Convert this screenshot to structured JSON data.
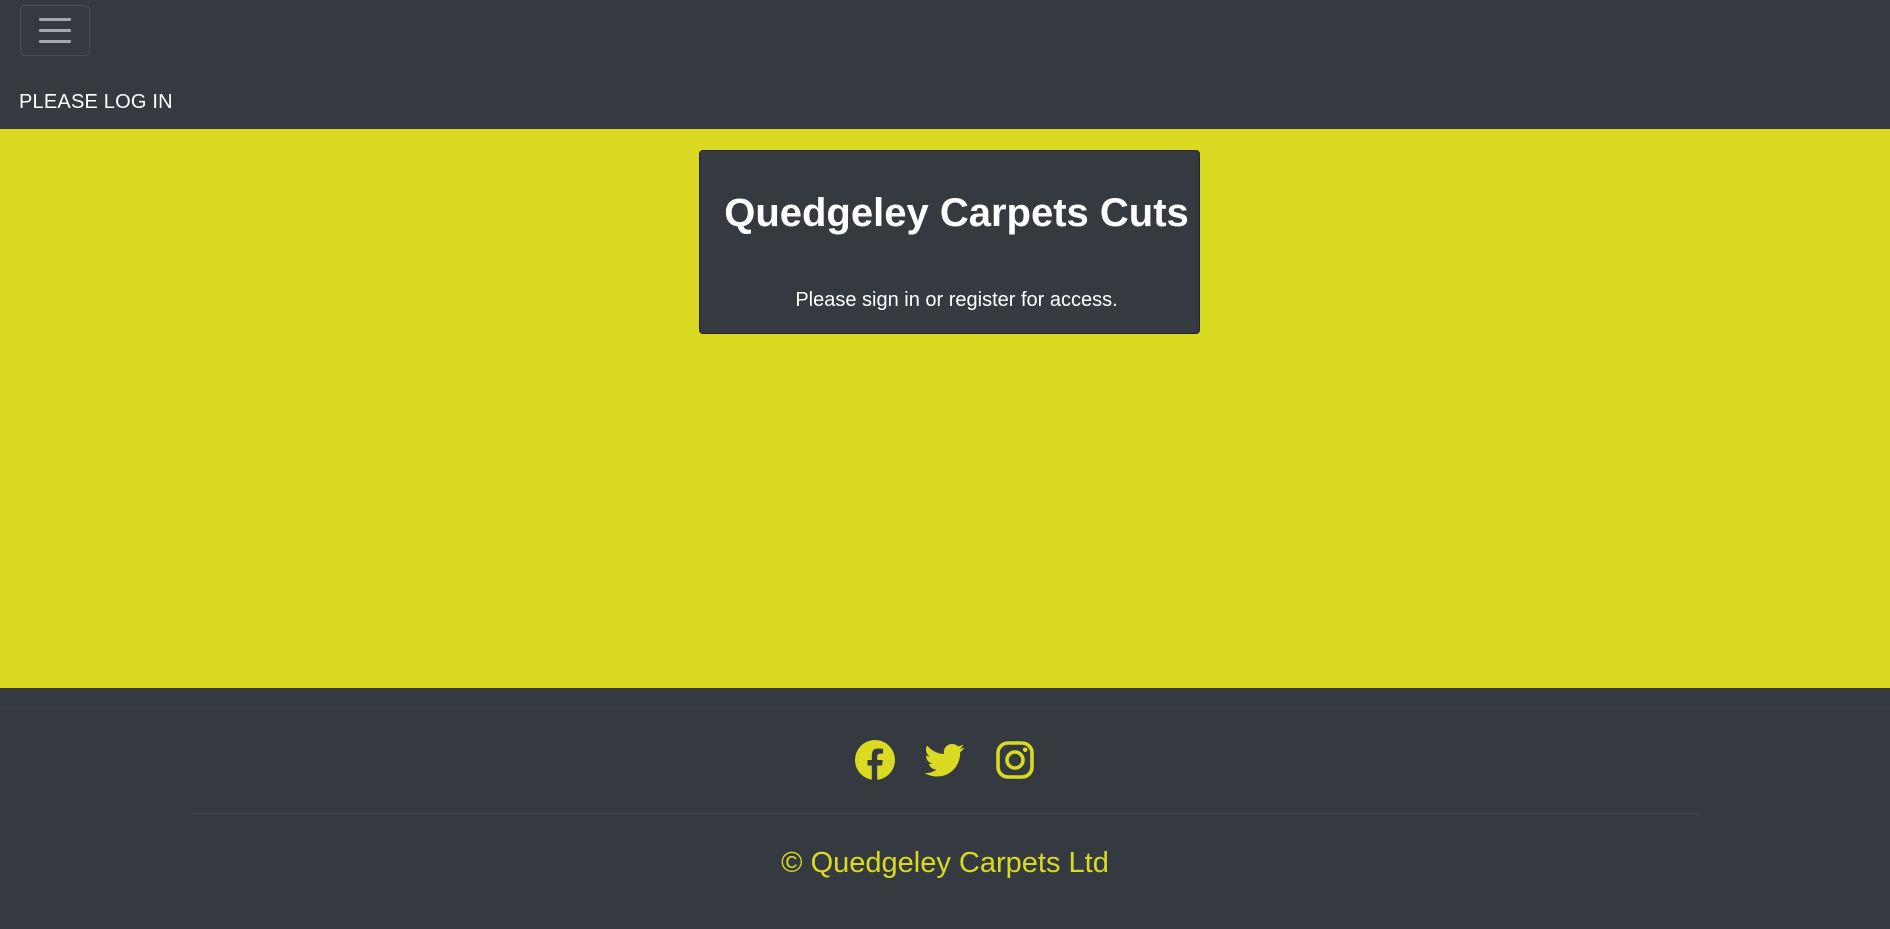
{
  "navbar": {
    "toggler_icon": "hamburger-menu-icon",
    "login_link": "PLEASE LOG IN"
  },
  "card": {
    "title": "Quedgeley Carpets Cuts",
    "text": "Please sign in or register for access."
  },
  "footer": {
    "social": [
      {
        "name": "facebook-icon"
      },
      {
        "name": "twitter-icon"
      },
      {
        "name": "instagram-icon"
      }
    ],
    "copyright": "© Quedgeley Carpets Ltd"
  },
  "colors": {
    "dark": "#343a40",
    "accent": "#dada22",
    "text": "#ffffff"
  }
}
